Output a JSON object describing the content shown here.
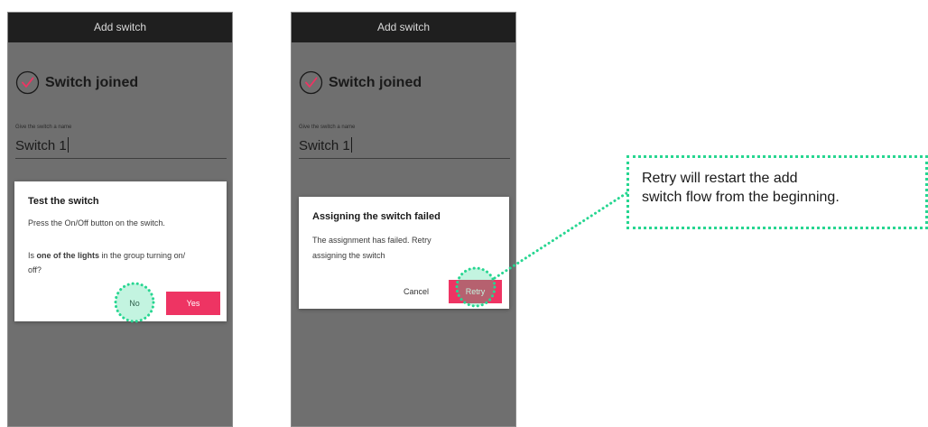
{
  "screens": [
    {
      "appbar_title": "Add switch",
      "joined_title": "Switch joined",
      "name_label": "Give the switch a name",
      "name_value": "Switch 1",
      "dialog": {
        "title": "Test the switch",
        "line1": "Press the On/Off button on the switch.",
        "question_prefix": "Is ",
        "question_bold": "one of the lights",
        "question_suffix": " in the group turning on/",
        "question_line2": "off?",
        "no_label": "No",
        "yes_label": "Yes"
      }
    },
    {
      "appbar_title": "Add switch",
      "joined_title": "Switch joined",
      "name_label": "Give the switch a name",
      "name_value": "Switch 1",
      "dialog": {
        "title": "Assigning the switch failed",
        "line1": "The assignment has failed. Retry",
        "line2": "assigning the switch",
        "cancel_label": "Cancel",
        "retry_label": "Retry"
      }
    }
  ],
  "annotation": {
    "line1": "Retry will restart the add",
    "line2": "switch flow from the beginning."
  },
  "colors": {
    "accent": "#ee3463",
    "highlight": "#27d691",
    "screen_bg": "#6f6f6f",
    "appbar_bg": "#1f1f1f"
  }
}
